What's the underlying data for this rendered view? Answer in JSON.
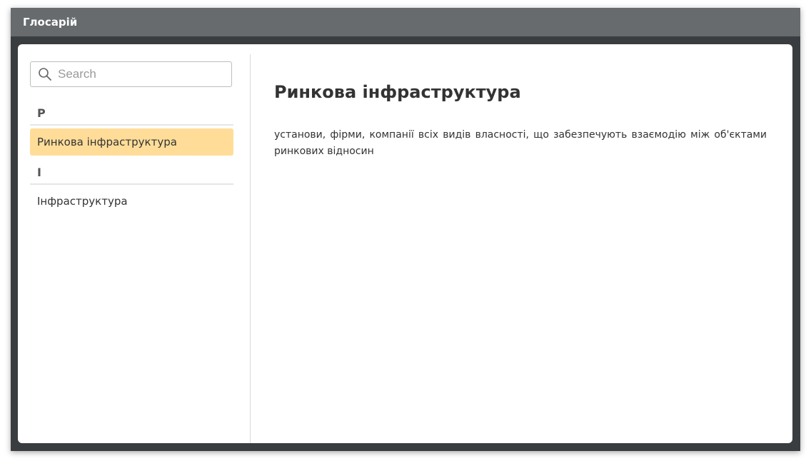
{
  "window": {
    "title": "Глосарій"
  },
  "search": {
    "placeholder": "Search",
    "value": ""
  },
  "sidebar": {
    "groups": [
      {
        "letter": "Р",
        "items": [
          {
            "label": "Ринкова інфраструктура",
            "selected": true
          }
        ]
      },
      {
        "letter": "І",
        "items": [
          {
            "label": "Інфраструктура",
            "selected": false
          }
        ]
      }
    ]
  },
  "content": {
    "title": "Ринкова інфраструктура",
    "definition": "установи, фірми, компанії всіх видів власності, що забезпечують взаємодію між об'єктами ринкових відносин"
  },
  "colors": {
    "titlebar": "#676b6e",
    "frame": "#3a3d3f",
    "selected_item": "#ffdd99"
  }
}
